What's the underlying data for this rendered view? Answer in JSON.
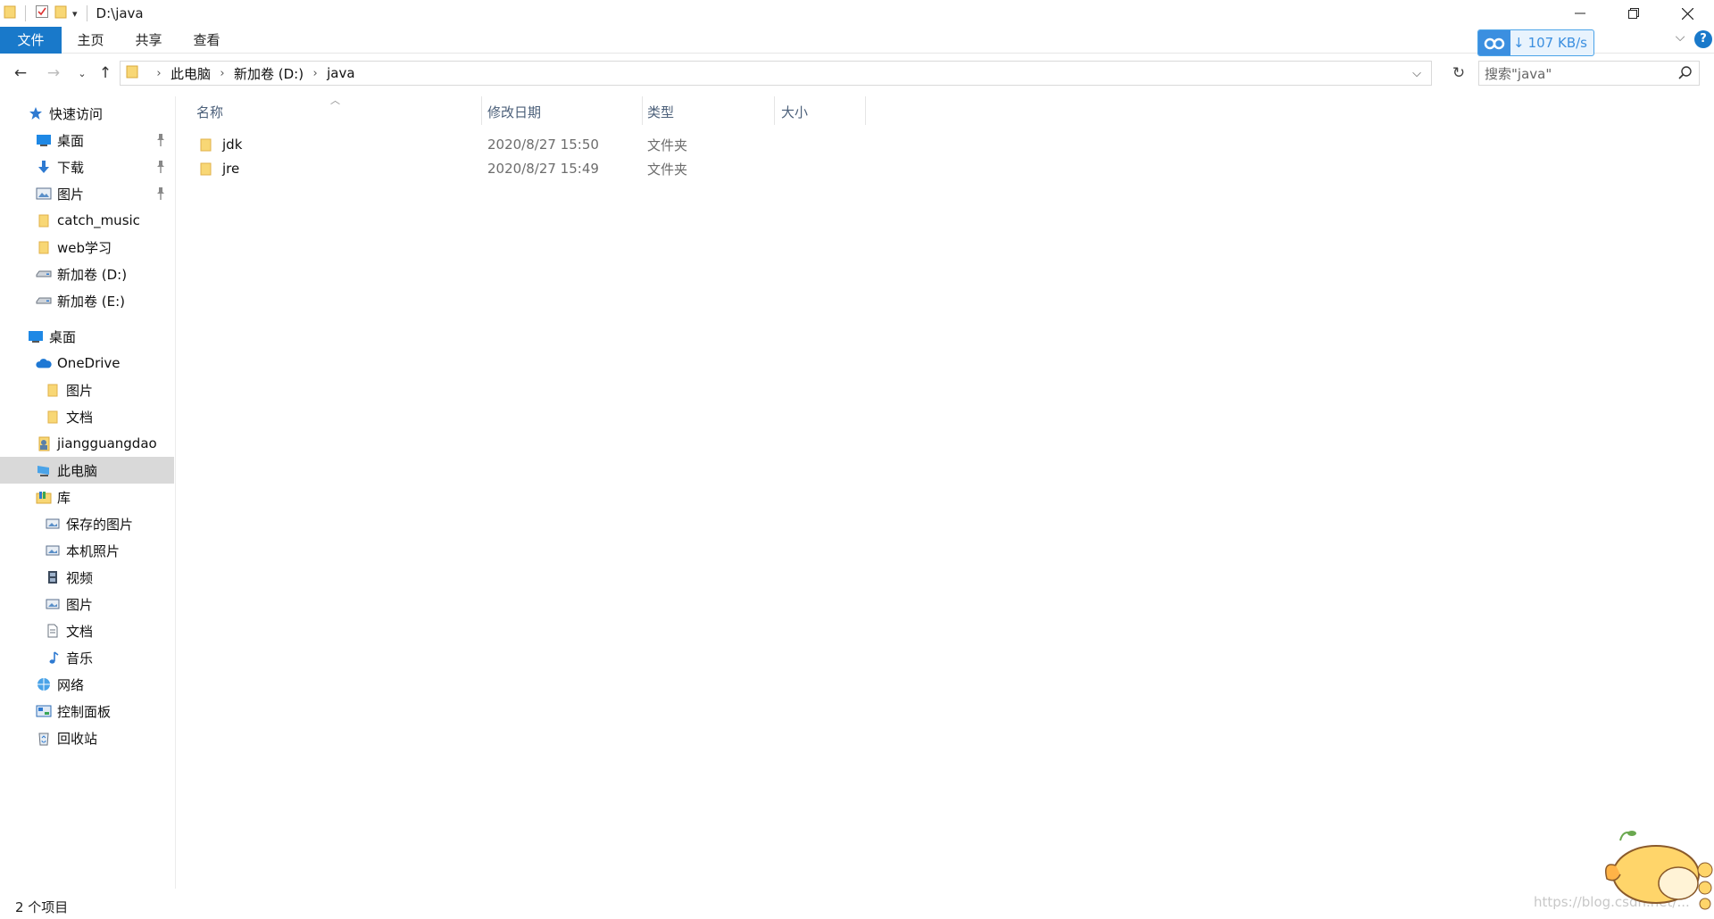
{
  "window": {
    "title": "D:\\java"
  },
  "ribbon": {
    "tabs": [
      {
        "label": "文件"
      },
      {
        "label": "主页"
      },
      {
        "label": "共享"
      },
      {
        "label": "查看"
      }
    ],
    "speed_label": "107 KB/s",
    "help_label": "?"
  },
  "address": {
    "crumbs": [
      "此电脑",
      "新加卷 (D:)",
      "java"
    ]
  },
  "search": {
    "placeholder": "搜索\"java\""
  },
  "nav_pane": {
    "items": [
      {
        "label": "快速访问",
        "icon": "star-icon"
      },
      {
        "label": "桌面",
        "icon": "desktop-icon",
        "pinned": true
      },
      {
        "label": "下载",
        "icon": "download-icon",
        "pinned": true
      },
      {
        "label": "图片",
        "icon": "pictures-icon",
        "pinned": true
      },
      {
        "label": "catch_music",
        "icon": "folder-icon"
      },
      {
        "label": "web学习",
        "icon": "folder-icon"
      },
      {
        "label": "新加卷 (D:)",
        "icon": "drive-icon"
      },
      {
        "label": "新加卷 (E:)",
        "icon": "drive-icon"
      },
      {
        "label": "桌面",
        "icon": "desktop-icon"
      },
      {
        "label": "OneDrive",
        "icon": "onedrive-icon"
      },
      {
        "label": "图片",
        "icon": "folder-icon"
      },
      {
        "label": "文档",
        "icon": "folder-icon"
      },
      {
        "label": "jiangguangdao",
        "icon": "user-icon"
      },
      {
        "label": "此电脑",
        "icon": "this-pc-icon",
        "selected": true
      },
      {
        "label": "库",
        "icon": "library-icon"
      },
      {
        "label": "保存的图片",
        "icon": "saved-pictures-icon"
      },
      {
        "label": "本机照片",
        "icon": "camera-roll-icon"
      },
      {
        "label": "视频",
        "icon": "videos-icon"
      },
      {
        "label": "图片",
        "icon": "pictures-icon"
      },
      {
        "label": "文档",
        "icon": "documents-icon"
      },
      {
        "label": "音乐",
        "icon": "music-icon"
      },
      {
        "label": "网络",
        "icon": "network-icon"
      },
      {
        "label": "控制面板",
        "icon": "control-panel-icon"
      },
      {
        "label": "回收站",
        "icon": "recycle-bin-icon"
      }
    ]
  },
  "file_list": {
    "columns": [
      "名称",
      "修改日期",
      "类型",
      "大小"
    ],
    "rows": [
      {
        "name": "jdk",
        "modified": "2020/8/27 15:50",
        "type": "文件夹",
        "size": ""
      },
      {
        "name": "jre",
        "modified": "2020/8/27 15:49",
        "type": "文件夹",
        "size": ""
      }
    ]
  },
  "status": {
    "item_count": "2 个项目"
  },
  "watermark": {
    "text": "https://blog.csdn.net/..."
  },
  "colors": {
    "accent": "#1979ca",
    "selection": "#d9d9d9",
    "folder": "#f8d775",
    "header_text": "#4c607a"
  }
}
